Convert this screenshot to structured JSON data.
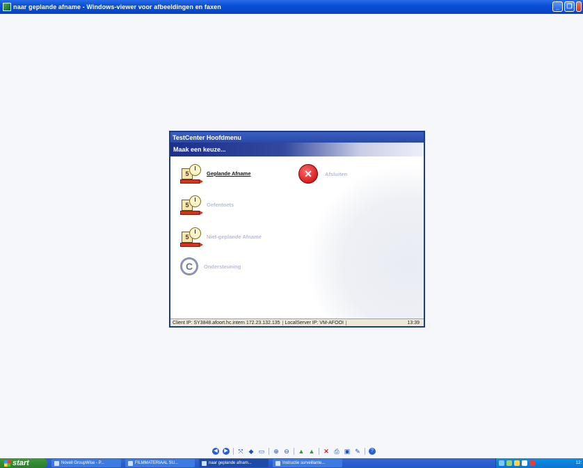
{
  "window": {
    "title": "naar geplande afname - Windows-viewer voor afbeeldingen en faxen"
  },
  "dialog": {
    "title": "TestCenter Hoofdmenu",
    "header": "Maak een keuze...",
    "items": [
      {
        "label": "Geplande Afname",
        "state": "active",
        "icon": "test-clock-pencil-icon"
      },
      {
        "label": "Afsluiten",
        "state": "inactive",
        "icon": "close-icon"
      },
      {
        "label": "Oefentoets",
        "state": "inactive",
        "icon": "test-clock-pencil-icon"
      },
      {
        "label": "Niet-geplande Afname",
        "state": "inactive",
        "icon": "test-clock-pencil-icon"
      },
      {
        "label": "Ondersteuning",
        "state": "inactive",
        "icon": "copyright-icon"
      }
    ],
    "status": {
      "client": "Client IP: SY3848.afoort.hc.intern 172.23.132.135",
      "server": "LocalServer IP: VM-AFOOI",
      "time": "13:39"
    }
  },
  "taskbar": {
    "start": "start",
    "tasks": [
      {
        "label": "Novell GroupWise - P..."
      },
      {
        "label": "FILMMATERIAAL SU..."
      },
      {
        "label": "naar geplande afnam..."
      },
      {
        "label": "Instructie surveillante..."
      }
    ],
    "clock": "12:"
  },
  "colors": {
    "title_bar": "#0a4fd6",
    "dialog_header": "#1c2f8c",
    "inactive_text": "#b7bcd6",
    "close_red": "#c40000"
  }
}
